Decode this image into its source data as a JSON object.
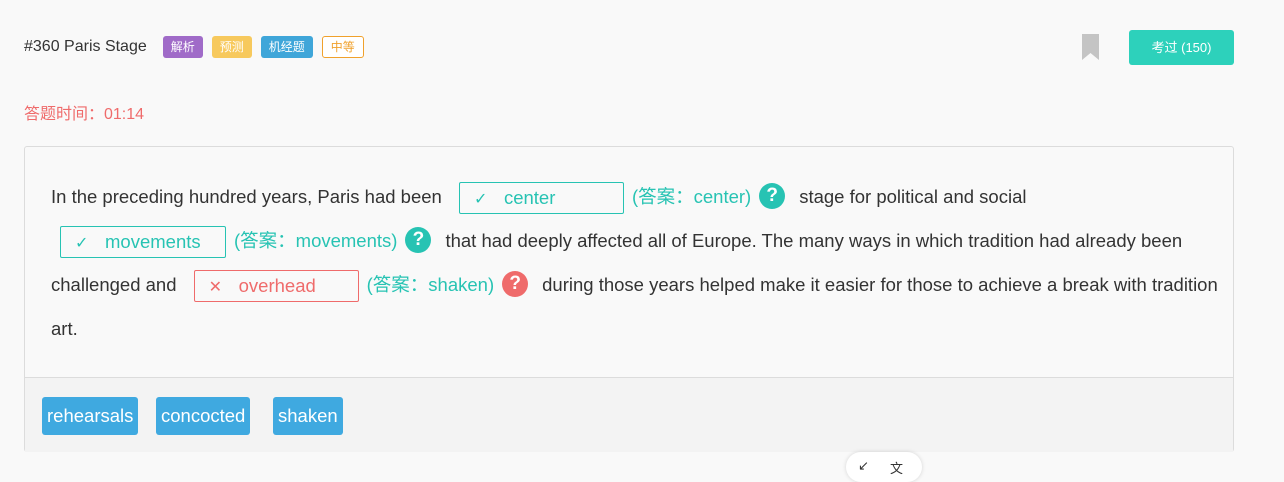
{
  "header": {
    "title": "#360 Paris Stage",
    "tags": [
      {
        "label": "解析",
        "color": "#a06bc8"
      },
      {
        "label": "预测",
        "color": "#f7c95d"
      },
      {
        "label": "机经题",
        "color": "#3fa6d9"
      },
      {
        "label": "中等",
        "color": "#f0a12c"
      }
    ],
    "taken_button": "考过 (150)"
  },
  "timer": "答题时间：01:14",
  "passage": {
    "seg1": "In the preceding hundred years, Paris had been",
    "blank1": {
      "mark": "✓",
      "value": "center",
      "answer": "(答案：center)",
      "state": "correct"
    },
    "seg2": "stage for political and social",
    "blank2": {
      "mark": "✓",
      "value": "movements",
      "answer": "(答案：movements)",
      "state": "correct"
    },
    "seg3": "that had deeply affected all of Europe. The many ways in which tradition had already been challenged and",
    "blank3": {
      "mark": "✕",
      "value": "overhead",
      "answer": "(答案：shaken)",
      "state": "wrong"
    },
    "seg4": "during those years helped make it easier for those to achieve a break with tradition art.",
    "help_symbol": "?"
  },
  "options": [
    "rehearsals",
    "concocted",
    "shaken"
  ],
  "floater": {
    "left": "↙",
    "right": "文"
  },
  "colors": {
    "accent": "#2dd1bb",
    "correct": "#27c3b3",
    "wrong": "#ef6b6b",
    "option_bg": "#3fa9e0"
  },
  "icons": [
    "bookmark-icon",
    "check-icon",
    "cross-icon",
    "question-icon"
  ]
}
